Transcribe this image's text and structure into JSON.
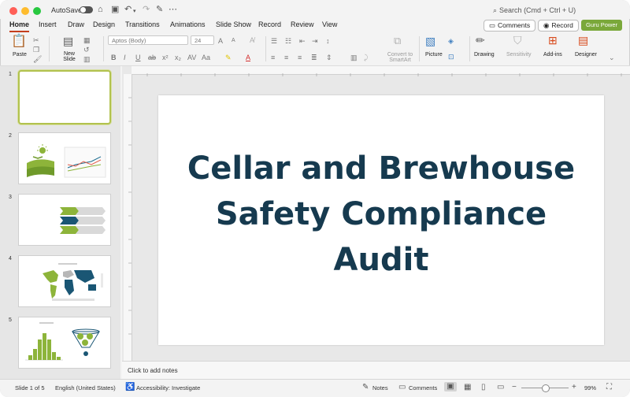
{
  "titlebar": {
    "autosave_label": "AutoSave",
    "search_placeholder": "Search (Cmd + Ctrl + U)"
  },
  "tabs": [
    "Home",
    "Insert",
    "Draw",
    "Design",
    "Transitions",
    "Animations",
    "Slide Show",
    "Record",
    "Review",
    "View"
  ],
  "actions": {
    "comments": "Comments",
    "record": "Record",
    "guru": "Guru Power"
  },
  "ribbon": {
    "paste": "Paste",
    "new_slide": "New Slide",
    "font_name": "Aptos (Body)",
    "font_size": "24",
    "convert_smartart": "Convert to SmartArt",
    "picture": "Picture",
    "drawing": "Drawing",
    "sensitivity": "Sensitivity",
    "addins": "Add-ins",
    "designer": "Designer"
  },
  "slides": [
    {
      "number": "1"
    },
    {
      "number": "2"
    },
    {
      "number": "3"
    },
    {
      "number": "4"
    },
    {
      "number": "5"
    }
  ],
  "slide": {
    "title_line1": "Cellar and Brewhouse",
    "title_line2": "Safety Compliance",
    "title_line3": "Audit"
  },
  "notes_placeholder": "Click to add notes",
  "status": {
    "slide_count": "Slide 1 of 5",
    "language": "English (United States)",
    "accessibility": "Accessibility: Investigate",
    "notes": "Notes",
    "comments": "Comments",
    "zoom": "99%"
  },
  "colors": {
    "accent_tab": "#c43e1c",
    "guru_button": "#7aa83a",
    "title_text": "#163a4f",
    "selection": "#b2c24f"
  }
}
